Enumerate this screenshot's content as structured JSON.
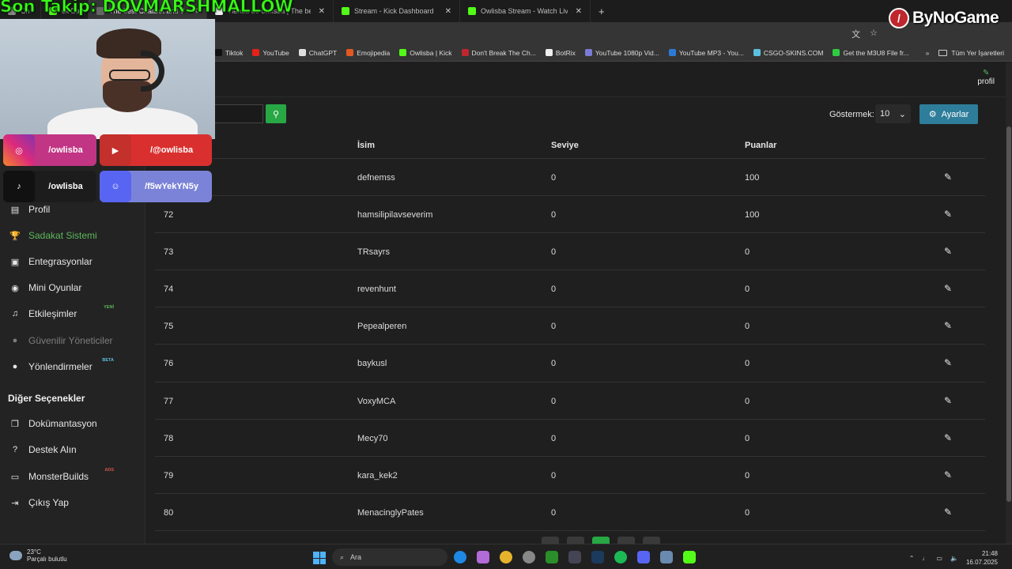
{
  "overlay": {
    "follow_text": "Son Takip: DOVMARSHMALLOW",
    "brand": "ByNoGame",
    "socials": [
      {
        "name": "instagram",
        "handle": "/owlisba"
      },
      {
        "name": "youtube",
        "handle": "/@owlisba"
      },
      {
        "name": "tiktok",
        "handle": "/owlisba"
      },
      {
        "name": "discord",
        "handle": "/f5wYekYN5y"
      }
    ]
  },
  "browser": {
    "tabs": [
      {
        "label": "Ch",
        "color": "#888"
      },
      {
        "label": "ck Da",
        "color": "#53fc18"
      },
      {
        "label": "The best ChatBot and Widgets",
        "color": "#666",
        "active": true
      },
      {
        "label": "Tienda de owlisba | The best Ch",
        "color": "#eee"
      },
      {
        "label": "Stream - Kick Dashboard",
        "color": "#53fc18"
      },
      {
        "label": "Owlisba Stream - Watch Live on",
        "color": "#53fc18"
      }
    ],
    "new_tab": "+",
    "bookmarks": [
      {
        "label": "Tiktok",
        "color": "#111"
      },
      {
        "label": "YouTube",
        "color": "#e62117"
      },
      {
        "label": "ChatGPT",
        "color": "#ddd"
      },
      {
        "label": "Emojipedia",
        "color": "#e25822"
      },
      {
        "label": "Owlisba | Kick",
        "color": "#53fc18"
      },
      {
        "label": "Don't Break The Ch...",
        "color": "#c0262d"
      },
      {
        "label": "BotRix",
        "color": "#eee"
      },
      {
        "label": "YouTube 1080p Vid...",
        "color": "#7b7bd6"
      },
      {
        "label": "YouTube MP3 - You...",
        "color": "#2b7bd6"
      },
      {
        "label": "CSGO-SKINS.COM",
        "color": "#5bc0de"
      },
      {
        "label": "Get the M3U8 File fr...",
        "color": "#2ecc40"
      }
    ],
    "bookmarks_more": "»",
    "all_bookmarks": "Tüm Yer İşaretleri"
  },
  "header": {
    "profile_label": "profil"
  },
  "sidebar": {
    "items": [
      {
        "label": "Profil",
        "icon": "id-card-icon",
        "glyph": "▤"
      },
      {
        "label": "Sadakat Sistemi",
        "icon": "trophy-icon",
        "glyph": "🏆",
        "active": true
      },
      {
        "label": "Entegrasyonlar",
        "icon": "plug-icon",
        "glyph": "▣"
      },
      {
        "label": "Mini Oyunlar",
        "icon": "gamepad-icon",
        "glyph": "◉"
      },
      {
        "label": "Etkileşimler",
        "icon": "music-icon",
        "glyph": "♫",
        "badge": "YENİ"
      },
      {
        "label": "Güvenilir Yöneticiler",
        "icon": "users-icon",
        "glyph": "●",
        "disabled": true
      },
      {
        "label": "Yönlendirmeler",
        "icon": "user-group-icon",
        "glyph": "●",
        "badge": "BETA"
      }
    ],
    "section_title": "Diğer Seçenekler",
    "other_items": [
      {
        "label": "Dokümantasyon",
        "icon": "copy-icon",
        "glyph": "❐"
      },
      {
        "label": "Destek Alın",
        "icon": "question-icon",
        "glyph": "?"
      },
      {
        "label": "MonsterBuilds",
        "icon": "laptop-icon",
        "glyph": "▭",
        "badge": "ADS"
      },
      {
        "label": "Çıkış Yap",
        "icon": "sign-out-icon",
        "glyph": "⇥"
      }
    ]
  },
  "toolbar": {
    "search_icon": "search-icon",
    "show_label": "Göstermek:",
    "show_value": "10",
    "settings_label": "Ayarlar"
  },
  "table": {
    "headers": [
      "İsim",
      "Seviye",
      "Puanlar"
    ],
    "rows": [
      {
        "id": "",
        "name": "defnemss",
        "level": "0",
        "points": "100"
      },
      {
        "id": "72",
        "name": "hamsilipilavseverim",
        "level": "0",
        "points": "100"
      },
      {
        "id": "73",
        "name": "TRsayrs",
        "level": "0",
        "points": "0"
      },
      {
        "id": "74",
        "name": "revenhunt",
        "level": "0",
        "points": "0"
      },
      {
        "id": "75",
        "name": "Pepealperen",
        "level": "0",
        "points": "0"
      },
      {
        "id": "76",
        "name": "baykusl",
        "level": "0",
        "points": "0"
      },
      {
        "id": "77",
        "name": "VoxyMCA",
        "level": "0",
        "points": "0"
      },
      {
        "id": "78",
        "name": "Mecy70",
        "level": "0",
        "points": "0"
      },
      {
        "id": "79",
        "name": "kara_kek2",
        "level": "0",
        "points": "0"
      },
      {
        "id": "80",
        "name": "MenacinglyPates",
        "level": "0",
        "points": "0"
      }
    ]
  },
  "taskbar": {
    "temperature": "23°C",
    "weather": "Parçalı bulutlu",
    "search_label": "Ara",
    "time": "21:48",
    "date": "16.07.2025"
  }
}
